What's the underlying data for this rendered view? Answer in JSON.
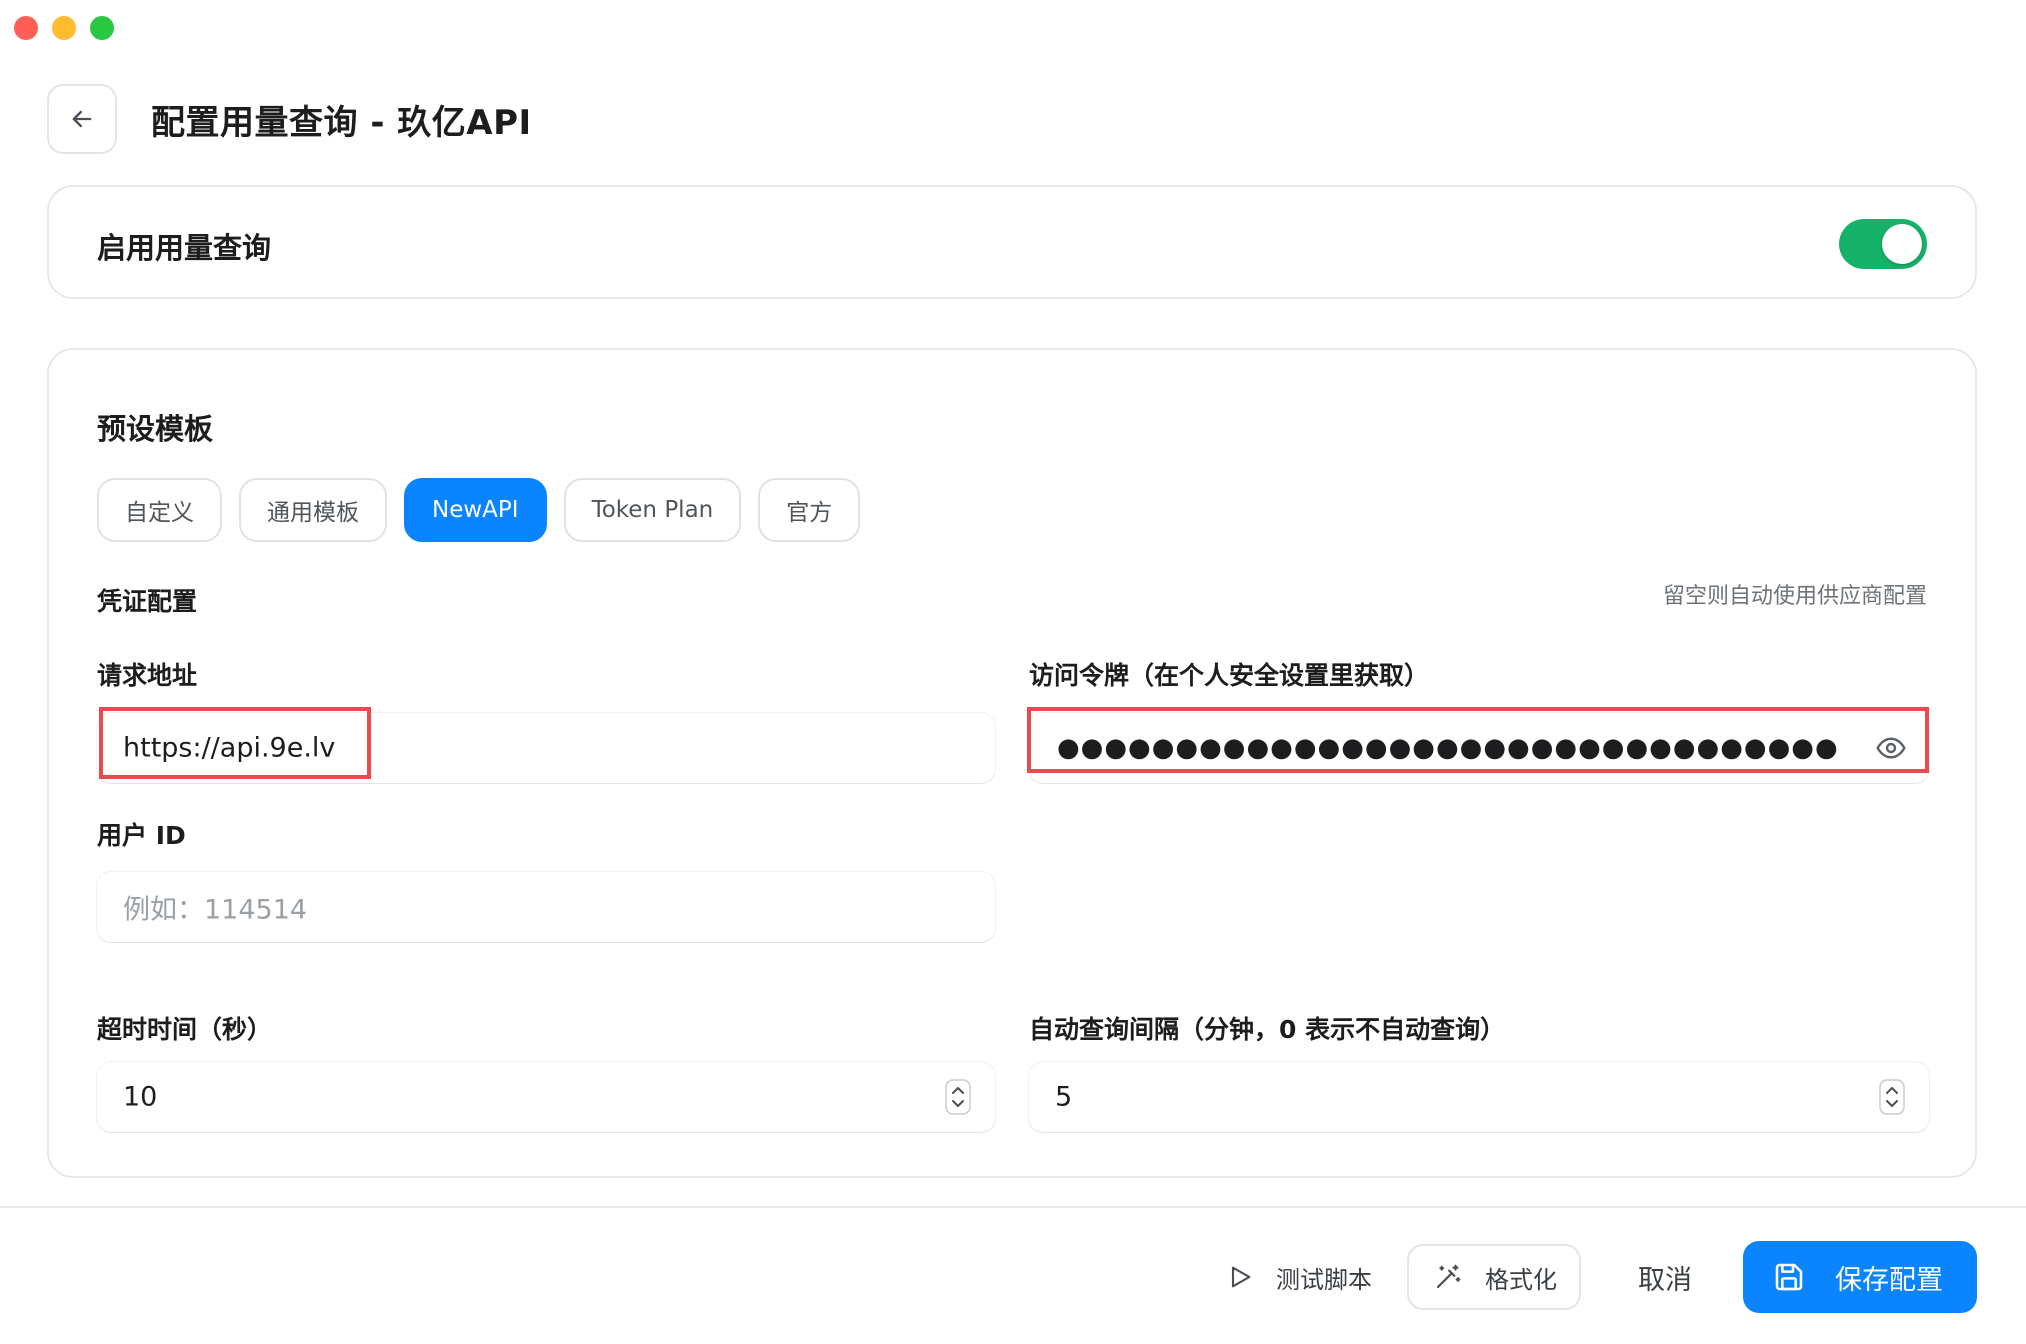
{
  "window": {
    "title": "配置用量查询 - 玖亿API"
  },
  "enable": {
    "label": "启用用量查询",
    "enabled": true
  },
  "templates": {
    "title": "预设模板",
    "chips": [
      {
        "label": "自定义",
        "active": false
      },
      {
        "label": "通用模板",
        "active": false
      },
      {
        "label": "NewAPI",
        "active": true
      },
      {
        "label": "Token Plan",
        "active": false
      },
      {
        "label": "官方",
        "active": false
      }
    ]
  },
  "credentials": {
    "title": "凭证配置",
    "hint": "留空则自动使用供应商配置",
    "request_url": {
      "label": "请求地址",
      "value": "https://api.9e.lv"
    },
    "access_token": {
      "label": "访问令牌（在个人安全设置里获取）",
      "masked_value": "●●●●●●●●●●●●●●●●●●●●●●●●●●●●●●●●●"
    },
    "user_id": {
      "label": "用户 ID",
      "placeholder": "例如：114514",
      "value": ""
    }
  },
  "timing": {
    "timeout": {
      "label": "超时时间（秒）",
      "value": "10"
    },
    "interval": {
      "label": "自动查询间隔（分钟，0 表示不自动查询）",
      "value": "5"
    }
  },
  "footer": {
    "test_label": "测试脚本",
    "format_label": "格式化",
    "cancel_label": "取消",
    "save_label": "保存配置"
  },
  "colors": {
    "accent": "#0a84ff",
    "toggle_on": "#17b26a",
    "highlight": "#ec4a4f"
  }
}
